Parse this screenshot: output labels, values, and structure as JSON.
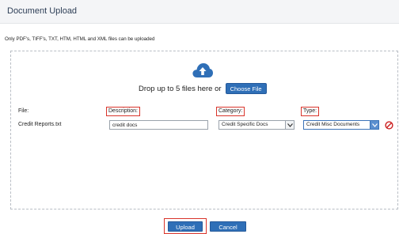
{
  "dialog": {
    "title": "Document Upload"
  },
  "notice": "Only PDF's, TIFF's, TXT, HTM, HTML and XML files can be uploaded",
  "dropzone": {
    "text": "Drop up to 5 files here or",
    "choose_label": "Choose File",
    "icon": "cloud-upload-icon"
  },
  "columns": {
    "file": "File:",
    "description": "Description:",
    "category": "Category:",
    "type": "Type:"
  },
  "row": {
    "filename": "Credit Reports.txt",
    "description_value": "credit docs",
    "category_value": "Credit Specific Docs",
    "type_value": "Credit Misc Documents"
  },
  "footer": {
    "upload_label": "Upload",
    "cancel_label": "Cancel"
  },
  "colors": {
    "accent": "#2f6fb7",
    "highlight": "#d9342b",
    "remove": "#cc1f1f"
  }
}
